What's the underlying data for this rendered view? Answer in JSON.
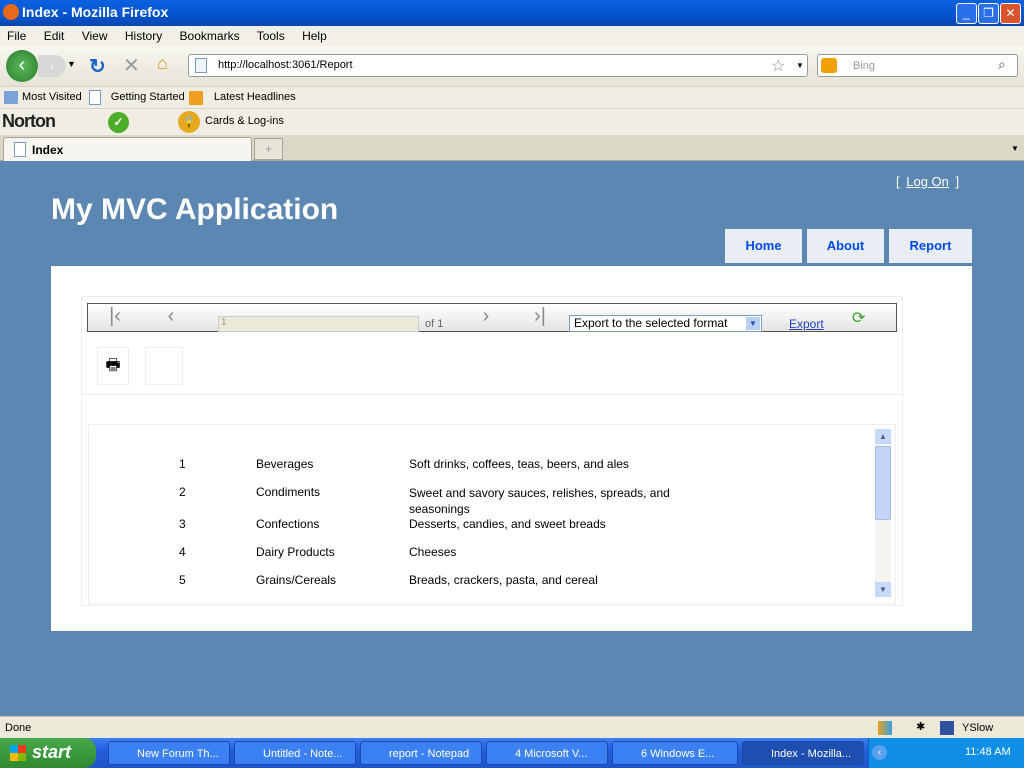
{
  "window": {
    "title": "Index - Mozilla Firefox"
  },
  "menu": [
    "File",
    "Edit",
    "View",
    "History",
    "Bookmarks",
    "Tools",
    "Help"
  ],
  "address": {
    "url": "http://localhost:3061/Report",
    "search_placeholder": "Bing"
  },
  "bookmarks": [
    "Most Visited",
    "Getting Started",
    "Latest Headlines"
  ],
  "norton": {
    "brand": "Norton",
    "cards": "Cards & Log-ins"
  },
  "tabs": [
    {
      "label": "Index"
    }
  ],
  "page": {
    "title": "My MVC Application",
    "logon_open": "[",
    "logon": "Log On",
    "logon_close": "]",
    "nav": [
      "Home",
      "About",
      "Report"
    ]
  },
  "report": {
    "page_value": "1",
    "of_label": "of 1",
    "export_select": "Export to the selected format",
    "export_link": "Export",
    "rows": [
      {
        "id": "1",
        "name": "Beverages",
        "desc": "Soft drinks, coffees, teas, beers, and ales"
      },
      {
        "id": "2",
        "name": "Condiments",
        "desc": "Sweet and savory sauces, relishes, spreads, and seasonings"
      },
      {
        "id": "3",
        "name": "Confections",
        "desc": "Desserts, candies, and sweet breads"
      },
      {
        "id": "4",
        "name": "Dairy Products",
        "desc": "Cheeses"
      },
      {
        "id": "5",
        "name": "Grains/Cereals",
        "desc": "Breads, crackers, pasta, and cereal"
      }
    ]
  },
  "status": {
    "text": "Done",
    "yslow": "YSlow"
  },
  "taskbar": {
    "start": "start",
    "items": [
      "New Forum Th...",
      "Untitled - Note...",
      "report - Notepad",
      "4 Microsoft V...",
      "6 Windows E...",
      "Index - Mozilla..."
    ],
    "clock": "11:48 AM"
  },
  "colors": {
    "page_bg": "#5c87b2",
    "nav_link": "#034af3"
  }
}
